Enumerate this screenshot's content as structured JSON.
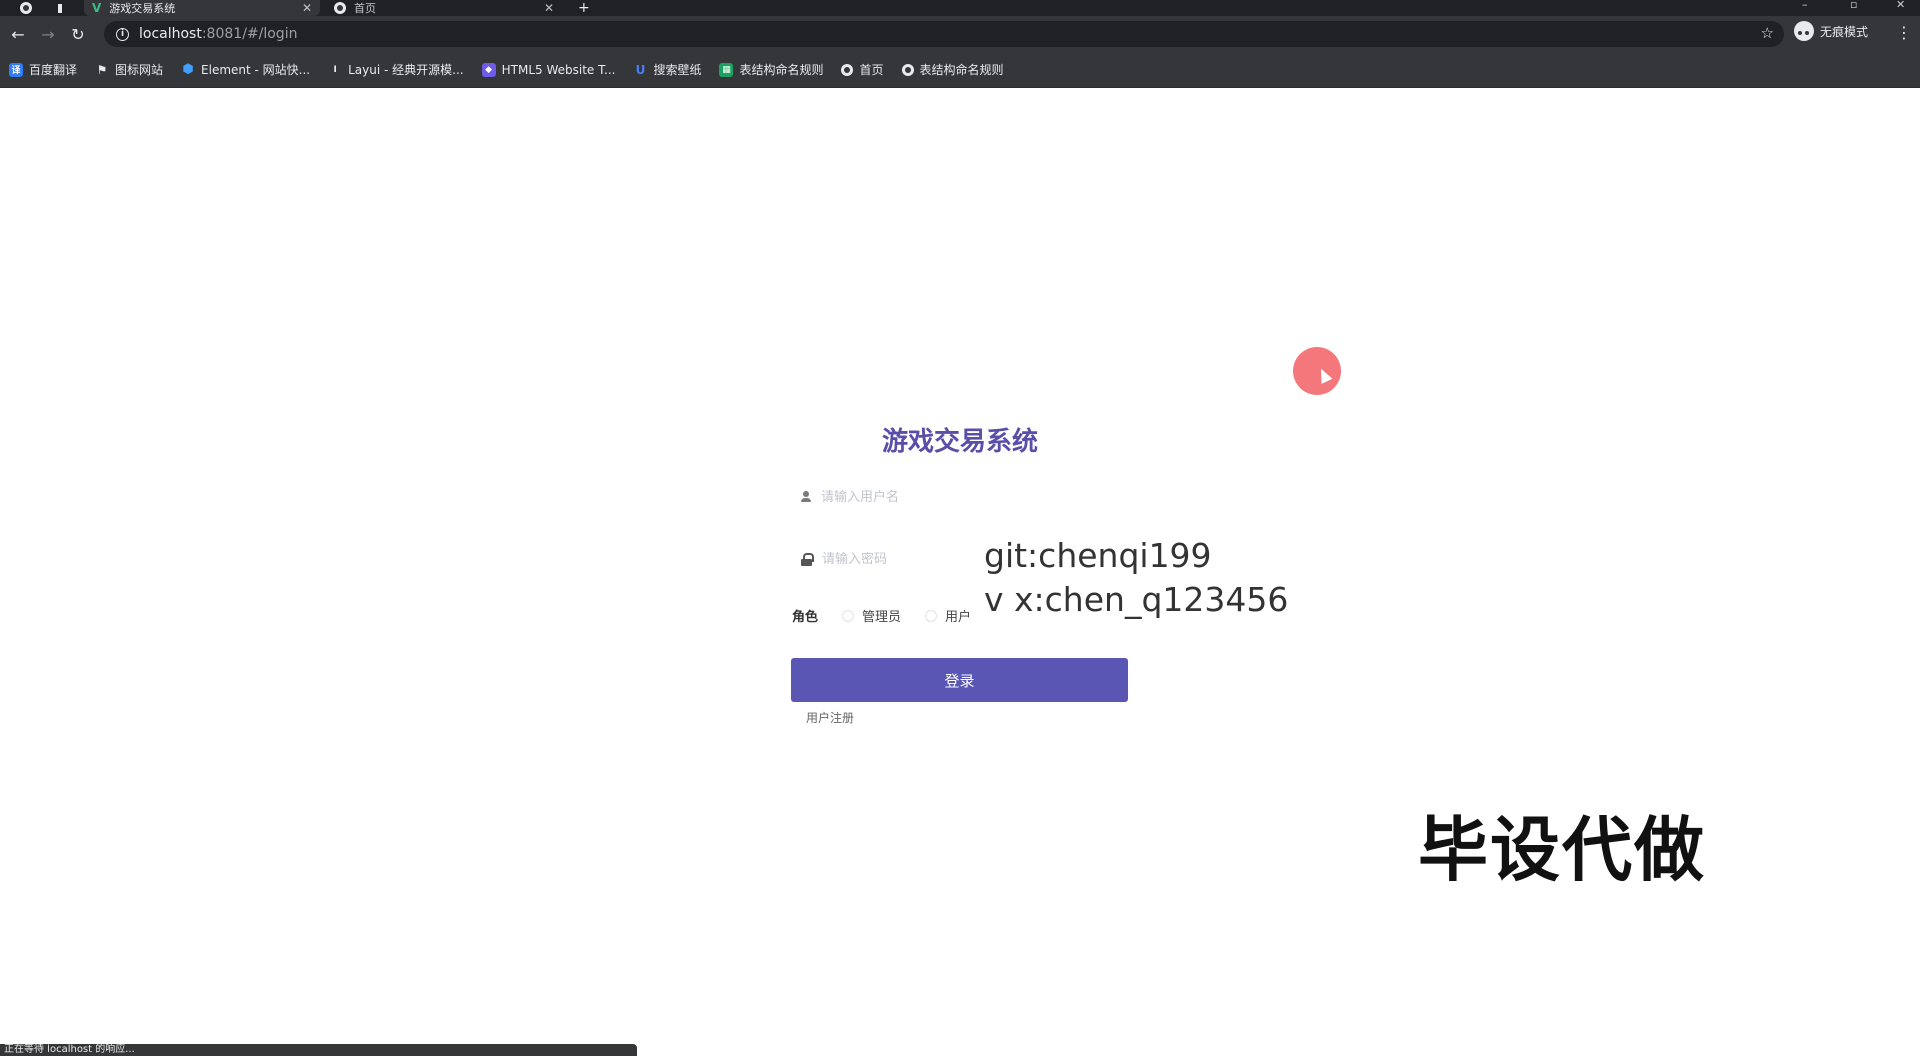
{
  "tabs": [
    {
      "title": "游戏交易系统",
      "active": true,
      "icon": "vue-icon"
    },
    {
      "title": "首页",
      "active": false,
      "icon": "globe-icon"
    }
  ],
  "new_tab": "+",
  "address_bar": {
    "host": "localhost",
    "rest": ":8081/#/login"
  },
  "profile": {
    "label": "无痕模式"
  },
  "bookmarks": [
    {
      "label": "百度翻译",
      "icon": "translate-icon",
      "color": "#2f7cf6"
    },
    {
      "label": "图标网站",
      "icon": "flag-icon",
      "color": "#e8eaed"
    },
    {
      "label": "Element - 网站快...",
      "icon": "element-icon",
      "color": "#409eff"
    },
    {
      "label": "Layui - 经典开源模...",
      "icon": "layui-icon",
      "color": "#e8eaed"
    },
    {
      "label": "HTML5 Website T...",
      "icon": "html5-icon",
      "color": "#6c5ce7"
    },
    {
      "label": "搜索壁纸",
      "icon": "wallpaper-icon",
      "color": "#4a7df0"
    },
    {
      "label": "表结构命名规则",
      "icon": "sheet-icon",
      "color": "#1aa260"
    },
    {
      "label": "首页",
      "icon": "globe-icon",
      "color": "#e8eaed"
    },
    {
      "label": "表结构命名规则",
      "icon": "globe-icon",
      "color": "#e8eaed"
    }
  ],
  "login": {
    "title": "游戏交易系统",
    "username_placeholder": "请输入用户名",
    "password_placeholder": "请输入密码",
    "role_label": "角色",
    "roles": [
      "管理员",
      "用户"
    ],
    "submit": "登录",
    "register": "用户注册"
  },
  "overlay": {
    "git": "git:chenqi199",
    "wx": "v x:chen_q123456",
    "banner": "毕设代做"
  },
  "status": "正在等待 localhost 的响应...",
  "colors": {
    "accent": "#5a56b4",
    "title": "#5a4fa8",
    "chrome": "#35363a"
  }
}
